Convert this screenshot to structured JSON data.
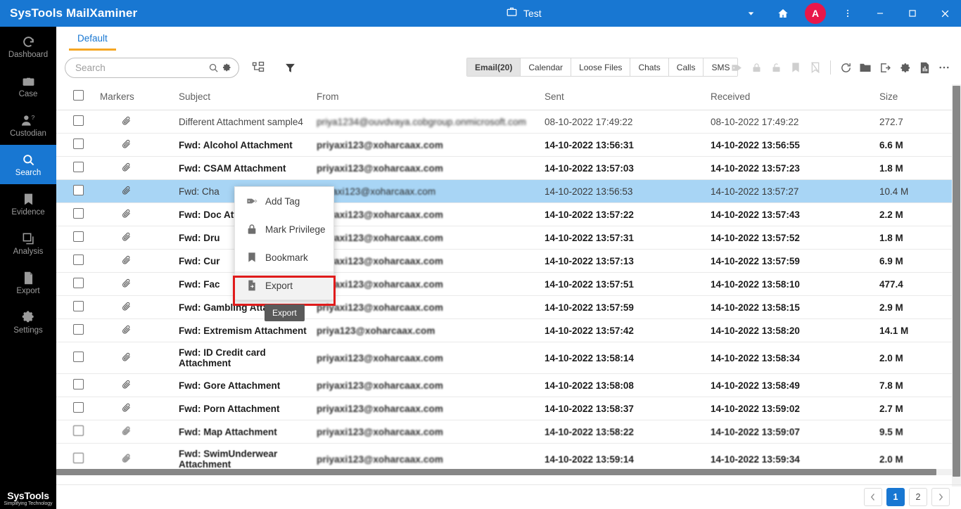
{
  "titlebar": {
    "app_title": "SysTools MailXaminer",
    "case_name": "Test",
    "case_icon": "briefcase-icon",
    "dropdown_icon": "chevron-down-icon",
    "home_icon": "home-icon",
    "avatar_initial": "A",
    "avatar_color": "#e8174a",
    "more_icon": "kebab-menu-icon",
    "minimize_icon": "minimize-icon",
    "maximize_icon": "maximize-icon",
    "close_icon": "close-icon",
    "background_color": "#1877d2"
  },
  "sidebar": {
    "items": [
      {
        "label": "Dashboard",
        "icon": "dashboard-icon",
        "active": false
      },
      {
        "label": "Case",
        "icon": "briefcase-icon",
        "active": false
      },
      {
        "label": "Custodian",
        "icon": "user-question-icon",
        "active": false
      },
      {
        "label": "Search",
        "icon": "search-icon",
        "active": true
      },
      {
        "label": "Evidence",
        "icon": "bookmark-icon",
        "active": false
      },
      {
        "label": "Analysis",
        "icon": "layers-icon",
        "active": false
      },
      {
        "label": "Export",
        "icon": "file-export-icon",
        "active": false
      },
      {
        "label": "Settings",
        "icon": "gear-icon",
        "active": false
      }
    ],
    "logo_primary": "SysTools",
    "logo_tagline": "Simplifying Technology"
  },
  "tabs": [
    {
      "label": "Default",
      "active": true
    }
  ],
  "search": {
    "value": "",
    "placeholder": "Search",
    "search_icon": "search-icon",
    "settings_icon": "gear-icon"
  },
  "toolbar": {
    "tree_icon": "hierarchy-icon",
    "filter_icon": "funnel-icon",
    "type_tabs": [
      {
        "label": "Email(20)",
        "active": true
      },
      {
        "label": "Calendar",
        "active": false
      },
      {
        "label": "Loose Files",
        "active": false
      },
      {
        "label": "Chats",
        "active": false
      },
      {
        "label": "Calls",
        "active": false
      },
      {
        "label": "SMS",
        "active": false
      }
    ],
    "right_icons": [
      {
        "name": "add-tag-icon",
        "enabled": false
      },
      {
        "name": "lock-closed-icon",
        "enabled": false
      },
      {
        "name": "lock-open-icon",
        "enabled": false
      },
      {
        "name": "bookmark-icon",
        "enabled": false
      },
      {
        "name": "bookmark-remove-icon",
        "enabled": false
      },
      {
        "name": "refresh-icon",
        "enabled": true
      },
      {
        "name": "folder-icon",
        "enabled": true
      },
      {
        "name": "export-icon",
        "enabled": true
      },
      {
        "name": "gear-icon",
        "enabled": true
      },
      {
        "name": "report-icon",
        "enabled": true
      },
      {
        "name": "more-horizontal-icon",
        "enabled": true
      }
    ]
  },
  "table": {
    "columns": [
      "",
      "Markers",
      "Subject",
      "From",
      "Sent",
      "Received",
      "Size"
    ],
    "rows": [
      {
        "marker": "paperclip-icon",
        "subject": "Different Attachment sample4",
        "from": "priya1234@ouvdvaya.cobgroup.onmicrosoft.com",
        "sent": "08-10-2022 17:49:22",
        "received": "08-10-2022 17:49:22",
        "size": "272.7",
        "state": "first"
      },
      {
        "marker": "paperclip-icon",
        "subject": "Fwd: Alcohol Attachment",
        "from": "priyaxi123@xoharcaax.com",
        "sent": "14-10-2022 13:56:31",
        "received": "14-10-2022 13:56:55",
        "size": "6.6 M",
        "state": "normal"
      },
      {
        "marker": "paperclip-icon",
        "subject": "Fwd: CSAM Attachment",
        "from": "priyaxi123@xoharcaax.com",
        "sent": "14-10-2022 13:57:03",
        "received": "14-10-2022 13:57:23",
        "size": "1.8 M",
        "state": "normal"
      },
      {
        "marker": "paperclip-icon",
        "subject": "Fwd: Cha",
        "from": "priyaxi123@xoharcaax.com",
        "sent": "14-10-2022 13:56:53",
        "received": "14-10-2022 13:57:27",
        "size": "10.4 M",
        "state": "selected"
      },
      {
        "marker": "paperclip-icon",
        "subject": "Fwd: Doc Attachme",
        "from": "priyaxi123@xoharcaax.com",
        "sent": "14-10-2022 13:57:22",
        "received": "14-10-2022 13:57:43",
        "size": "2.2 M",
        "state": "normal"
      },
      {
        "marker": "paperclip-icon",
        "subject": "Fwd: Dru",
        "from": "priyaxi123@xoharcaax.com",
        "sent": "14-10-2022 13:57:31",
        "received": "14-10-2022 13:57:52",
        "size": "1.8 M",
        "state": "normal"
      },
      {
        "marker": "paperclip-icon",
        "subject": "Fwd: Cur",
        "from": "priyaxi123@xoharcaax.com",
        "sent": "14-10-2022 13:57:13",
        "received": "14-10-2022 13:57:59",
        "size": "6.9 M",
        "state": "normal"
      },
      {
        "marker": "paperclip-icon",
        "subject": "Fwd: Fac",
        "from": "priyaxi123@xoharcaax.com",
        "sent": "14-10-2022 13:57:51",
        "received": "14-10-2022 13:58:10",
        "size": "477.4",
        "state": "normal"
      },
      {
        "marker": "paperclip-icon",
        "subject": "Fwd: Gambling Attachment",
        "from": "priyaxi123@xoharcaax.com",
        "sent": "14-10-2022 13:57:59",
        "received": "14-10-2022 13:58:15",
        "size": "2.9 M",
        "state": "normal"
      },
      {
        "marker": "paperclip-icon",
        "subject": "Fwd: Extremism Attachment",
        "from": "priya123@xoharcaax.com",
        "sent": "14-10-2022 13:57:42",
        "received": "14-10-2022 13:58:20",
        "size": "14.1 M",
        "state": "normal"
      },
      {
        "marker": "paperclip-icon",
        "subject": "Fwd: ID Credit card Attachment",
        "from": "priyaxi123@xoharcaax.com",
        "sent": "14-10-2022 13:58:14",
        "received": "14-10-2022 13:58:34",
        "size": "2.0 M",
        "state": "soft1"
      },
      {
        "marker": "paperclip-icon",
        "subject": "Fwd: Gore Attachment",
        "from": "priyaxi123@xoharcaax.com",
        "sent": "14-10-2022 13:58:08",
        "received": "14-10-2022 13:58:49",
        "size": "7.8 M",
        "state": "soft1"
      },
      {
        "marker": "paperclip-icon",
        "subject": "Fwd: Porn Attachment",
        "from": "priyaxi123@xoharcaax.com",
        "sent": "14-10-2022 13:58:37",
        "received": "14-10-2022 13:59:02",
        "size": "2.7 M",
        "state": "soft1"
      },
      {
        "marker": "paperclip-icon",
        "subject": "Fwd: Map Attachment",
        "from": "priyaxi123@xoharcaax.com",
        "sent": "14-10-2022 13:58:22",
        "received": "14-10-2022 13:59:07",
        "size": "9.5 M",
        "state": "soft2"
      },
      {
        "marker": "paperclip-icon",
        "subject": "Fwd: SwimUnderwear Attachment",
        "from": "priyaxi123@xoharcaax.com",
        "sent": "14-10-2022 13:59:14",
        "received": "14-10-2022 13:59:34",
        "size": "2.0 M",
        "state": "soft2"
      }
    ]
  },
  "context_menu": {
    "items": [
      {
        "label": "Add Tag",
        "icon": "add-tag-icon",
        "highlighted": false
      },
      {
        "label": "Mark Privilege",
        "icon": "lock-icon",
        "highlighted": false
      },
      {
        "label": "Bookmark",
        "icon": "bookmark-icon",
        "highlighted": false
      },
      {
        "label": "Export",
        "icon": "file-export-icon",
        "highlighted": true
      }
    ],
    "highlight_color": "#e01b1b",
    "tooltip": "Export"
  },
  "pagination": {
    "prev_icon": "chevron-left-icon",
    "next_icon": "chevron-right-icon",
    "pages": [
      {
        "label": "1",
        "current": true
      },
      {
        "label": "2",
        "current": false
      }
    ]
  }
}
